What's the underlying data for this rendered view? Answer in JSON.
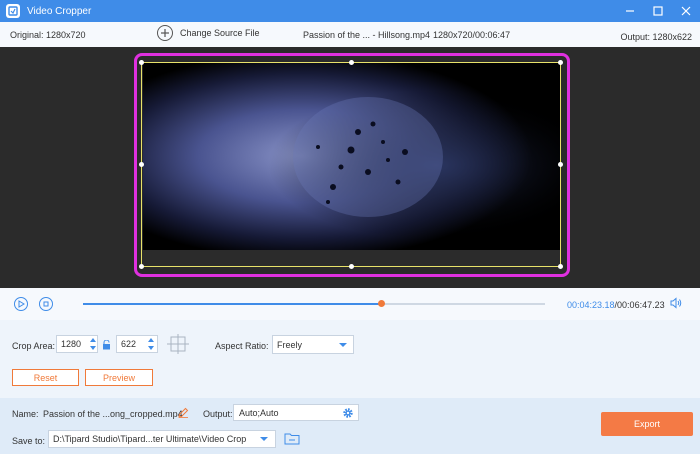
{
  "window": {
    "title": "Video Cropper"
  },
  "info": {
    "original": "Original: 1280x720",
    "change_source": "Change Source File",
    "file_name": "Passion of the ... - Hillsong.mp4",
    "file_meta": "1280x720/00:06:47",
    "output": "Output: 1280x622"
  },
  "playback": {
    "current_time": "00:04:23.18",
    "total_time": "/00:06:47.23",
    "progress_fraction": 0.646
  },
  "crop": {
    "label": "Crop Area:",
    "width": "1280",
    "height": "622",
    "aspect_label": "Aspect Ratio:",
    "aspect_value": "Freely",
    "reset_label": "Reset",
    "preview_label": "Preview"
  },
  "output": {
    "name_label": "Name:",
    "name_value": "Passion of the ...ong_cropped.mp4",
    "output_label": "Output:",
    "output_value": "Auto;Auto",
    "save_label": "Save to:",
    "save_path": "D:\\Tipard Studio\\Tipard...ter Ultimate\\Video Crop",
    "export_label": "Export"
  },
  "colors": {
    "accent": "#3f8ce8",
    "orange": "#f47a45",
    "selection": "#e030e0"
  }
}
